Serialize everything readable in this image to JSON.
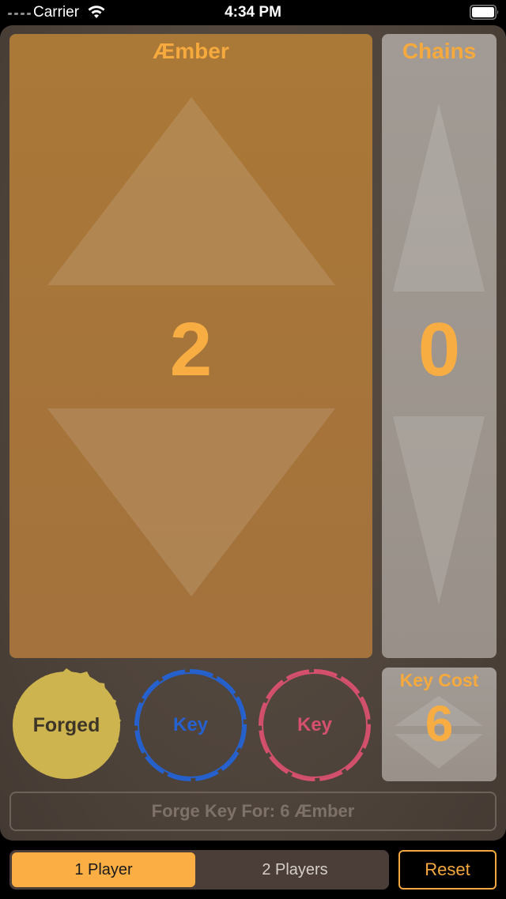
{
  "status_bar": {
    "carrier": "Carrier",
    "time": "4:34 PM",
    "wifi_icon": "wifi-icon",
    "battery_icon": "battery-full-icon"
  },
  "amber": {
    "title": "Æmber",
    "value": "2",
    "up_icon": "triangle-up-icon",
    "down_icon": "triangle-down-icon",
    "color": "#f8ad43"
  },
  "chains": {
    "title": "Chains",
    "value": "0",
    "up_icon": "triangle-up-icon",
    "down_icon": "triangle-down-icon"
  },
  "keys": {
    "forged": {
      "label": "Forged",
      "color": "#cdb44f"
    },
    "blue": {
      "label": "Key",
      "color": "#2561cf"
    },
    "red": {
      "label": "Key",
      "color": "#d4506c"
    }
  },
  "key_cost": {
    "title": "Key Cost",
    "value": "6"
  },
  "forge_button": {
    "label": "Forge Key For: 6 Æmber"
  },
  "player_mode": {
    "options": [
      "1 Player",
      "2 Players"
    ],
    "selected": "1 Player"
  },
  "reset_button": {
    "label": "Reset"
  }
}
